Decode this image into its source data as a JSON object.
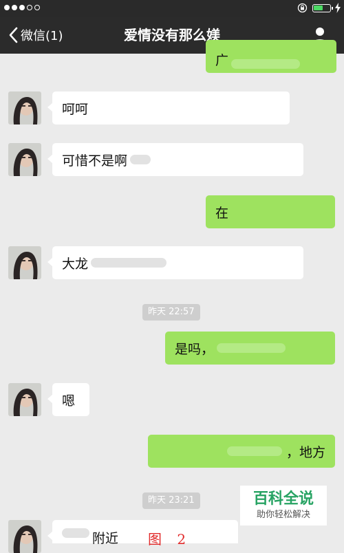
{
  "nav": {
    "back_label": "微信(1)",
    "title": "爱情没有那么媄"
  },
  "status_bar": {
    "battery_level_percent": 60,
    "battery_color": "#4cd964"
  },
  "colors": {
    "incoming_bubble": "#ffffff",
    "outgoing_bubble": "#9ee25f",
    "chat_background": "#ebebeb",
    "navbar": "#2b2b2b"
  },
  "messages": [
    {
      "side": "out",
      "text": "广"
    },
    {
      "side": "in",
      "text": "呵呵"
    },
    {
      "side": "in",
      "text": "可惜不是啊"
    },
    {
      "side": "out",
      "text": "在"
    },
    {
      "side": "in",
      "text": "大龙"
    },
    {
      "side": "time",
      "text": "昨天 22:57"
    },
    {
      "side": "out",
      "text": "是吗，"
    },
    {
      "side": "in",
      "text": "嗯"
    },
    {
      "side": "out",
      "text": "，地方"
    },
    {
      "side": "time",
      "text": "昨天 23:21"
    },
    {
      "side": "in",
      "text": "附近"
    }
  ],
  "annotation": {
    "figure_label": "图 2"
  },
  "watermark": {
    "title": "百科全说",
    "subtitle": "助你轻松解决"
  }
}
